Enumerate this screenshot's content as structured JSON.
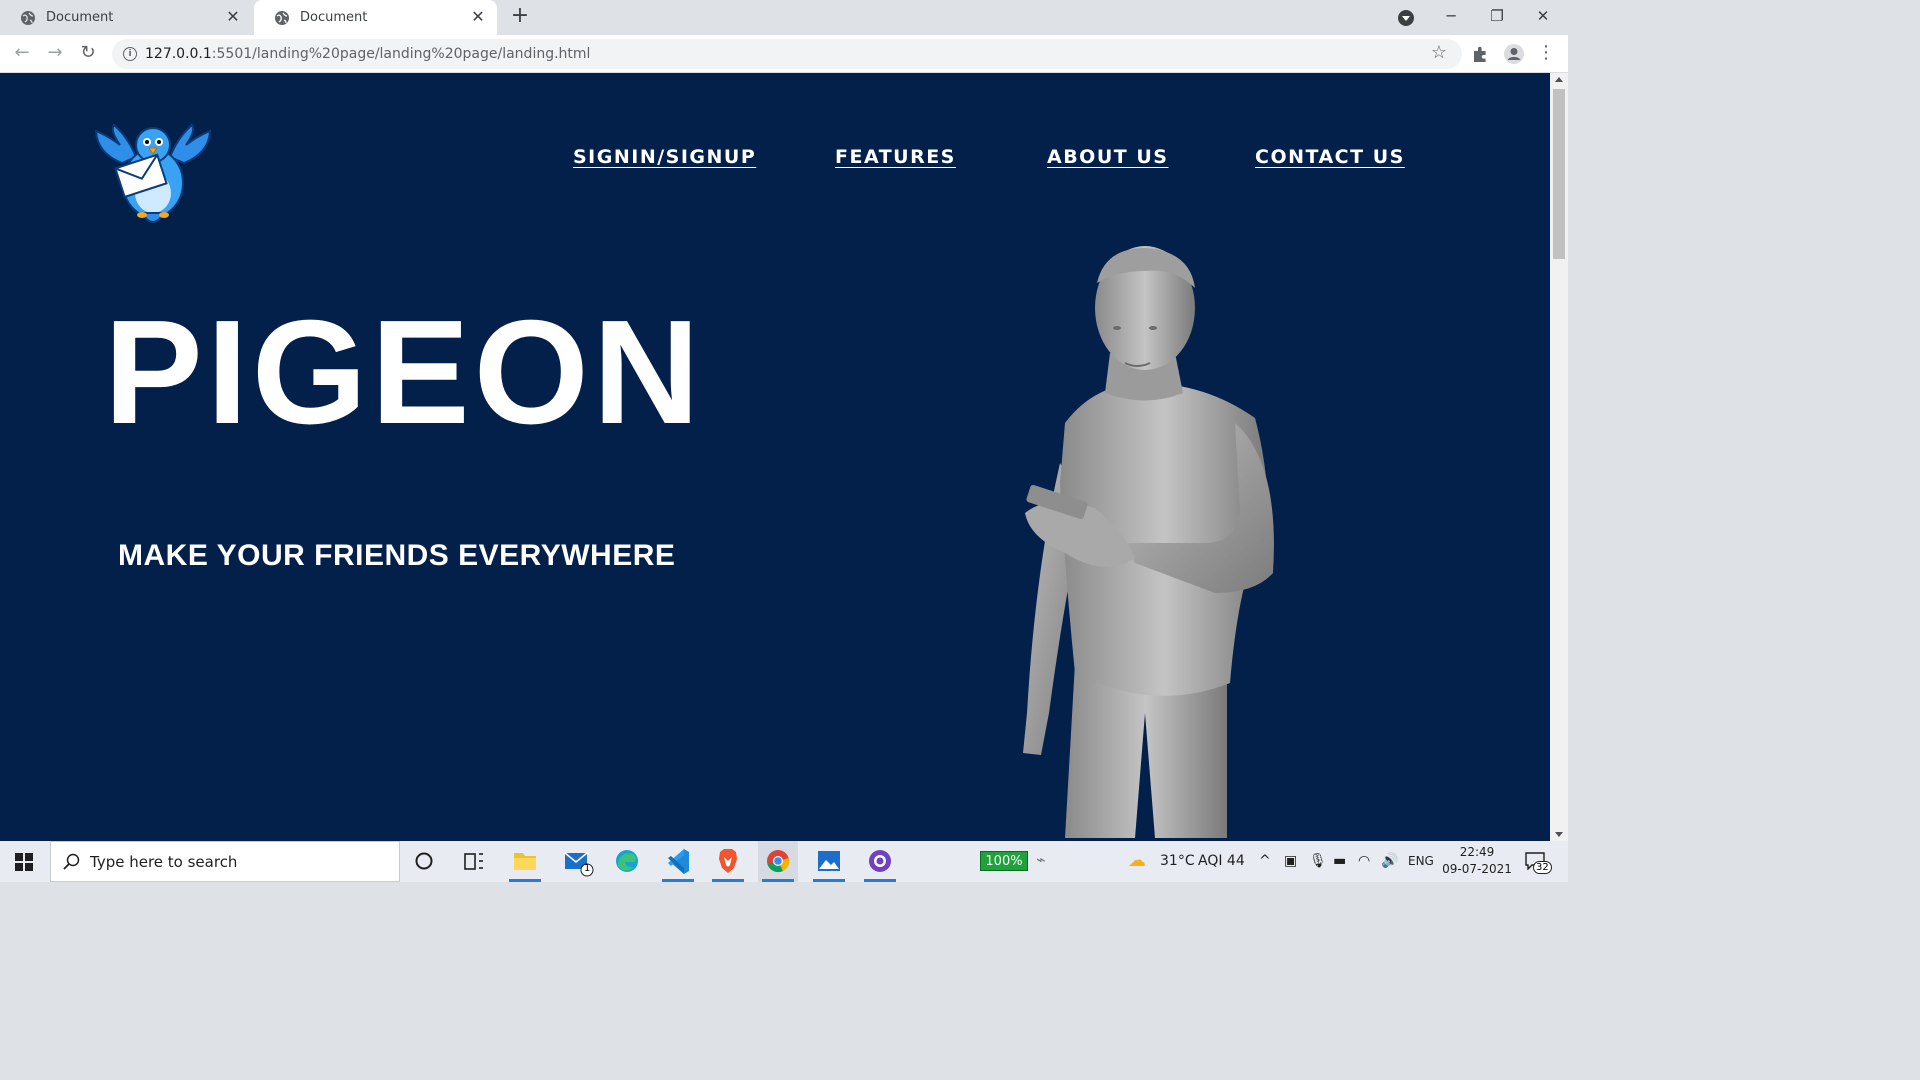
{
  "browser": {
    "tabs": [
      {
        "title": "Document",
        "active": false
      },
      {
        "title": "Document",
        "active": true
      }
    ],
    "new_tab_label": "+",
    "url_host": "127.0.0.1",
    "url_rest": ":5501/landing%20page/landing%20page/landing.html"
  },
  "page": {
    "nav": [
      "SIGNIN/SIGNUP",
      "FEATURES",
      "ABOUT US",
      "CONTACT US"
    ],
    "title": "PIGEON",
    "subtitle": "MAKE YOUR FRIENDS EVERYWHERE",
    "colors": {
      "background": "#03204a",
      "text": "#ffffff"
    }
  },
  "taskbar": {
    "search_placeholder": "Type here to search",
    "mail_badge": "1",
    "battery": "100%",
    "weather": "31°C",
    "aqi": "AQI 44",
    "language": "ENG",
    "time": "22:49",
    "date": "09-07-2021",
    "notifications": "32"
  }
}
